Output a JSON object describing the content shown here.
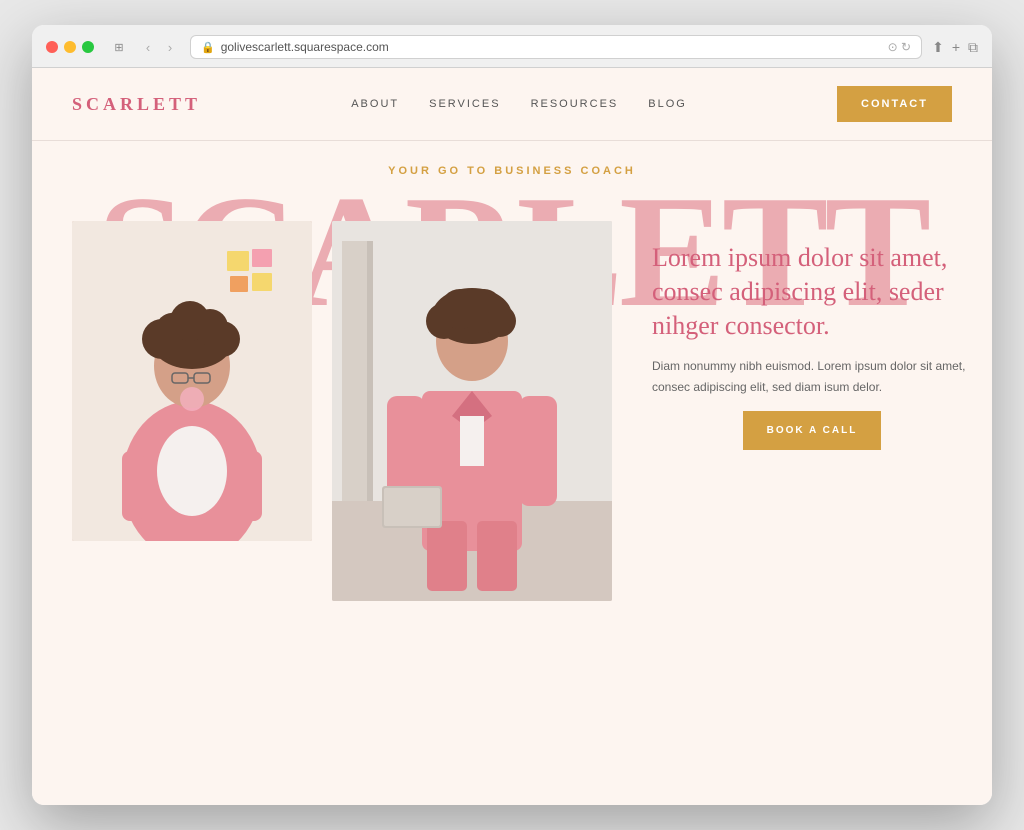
{
  "browser": {
    "url": "golivescarlett.squarespace.com",
    "traffic_lights": [
      "red",
      "yellow",
      "green"
    ]
  },
  "site": {
    "logo": "SCARLETT",
    "nav": {
      "items": [
        {
          "label": "ABOUT",
          "href": "#"
        },
        {
          "label": "SERVICES",
          "href": "#"
        },
        {
          "label": "RESOURCES",
          "href": "#"
        },
        {
          "label": "BLOG",
          "href": "#"
        }
      ],
      "contact_btn": "CONTACT"
    },
    "hero": {
      "tagline": "YOUR GO TO BUSINESS COACH",
      "big_text": "SCARLETT",
      "heading": "Lorem ipsum dolor sit amet, consec adipiscing elit, seder nihger consector.",
      "body": "Diam nonummy nibh euismod. Lorem ipsum dolor sit amet, consec adipiscing elit, sed diam isum delor.",
      "cta_btn": "BOOK A CALL"
    }
  }
}
